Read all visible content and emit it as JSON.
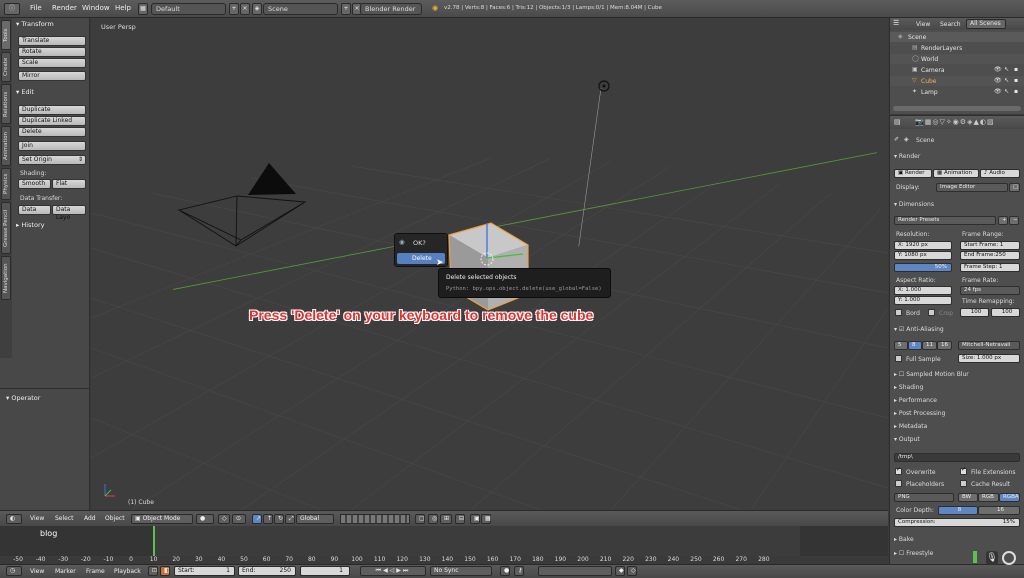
{
  "topbar": {
    "menus": [
      "File",
      "Render",
      "Window",
      "Help"
    ],
    "layout": "Default",
    "scene": "Scene",
    "engine": "Blender Render",
    "stats": "v2.78 | Verts:8 | Faces:6 | Tris:12 | Objects:1/3 | Lamps:0/1 | Mem:8.04M | Cube"
  },
  "toolbar": {
    "tabs": [
      "Tools",
      "Create",
      "Relations",
      "Animation",
      "Physics",
      "Grease Pencil"
    ],
    "tabs2": [
      "Navigation"
    ],
    "transform_header": "Transform",
    "translate": "Translate",
    "rotate": "Rotate",
    "scale": "Scale",
    "mirror": "Mirror",
    "edit_header": "Edit",
    "duplicate": "Duplicate",
    "duplicate_linked": "Duplicate Linked",
    "delete": "Delete",
    "join": "Join",
    "set_origin": "Set Origin",
    "shading_label": "Shading:",
    "smooth": "Smooth",
    "flat": "Flat",
    "data_transfer_label": "Data Transfer:",
    "data": "Data",
    "data_layout": "Data Layo",
    "history_header": "History",
    "operator_header": "Operator"
  },
  "viewport": {
    "view_name": "User Persp",
    "object_label": "(1) Cube",
    "popup_ok": "OK?",
    "popup_delete": "Delete",
    "tooltip_title": "Delete selected objects",
    "tooltip_python": "Python: bpy.ops.object.delete(use_global=False)",
    "instruction": "Press 'Delete' on your keyboard to remove the cube",
    "instruction_color": "#e03030"
  },
  "header3d": {
    "view": "View",
    "select": "Select",
    "add": "Add",
    "object": "Object",
    "mode": "Object Mode",
    "orientation": "Global"
  },
  "timeline": {
    "watermark": "blog",
    "ticks": [
      "-50",
      "-40",
      "-30",
      "-20",
      "-10",
      "0",
      "10",
      "20",
      "30",
      "40",
      "50",
      "60",
      "70",
      "80",
      "90",
      "100",
      "110",
      "120",
      "130",
      "140",
      "150",
      "160",
      "170",
      "180",
      "190",
      "200",
      "210",
      "220",
      "230",
      "240",
      "250",
      "260",
      "270",
      "280"
    ],
    "view": "View",
    "marker": "Marker",
    "frame": "Frame",
    "playback": "Playback",
    "start_label": "Start:",
    "start_value": "1",
    "end_label": "End:",
    "end_value": "250",
    "current": "1",
    "sync": "No Sync"
  },
  "outliner": {
    "view": "View",
    "search": "Search",
    "filter": "All Scenes",
    "items": [
      "Scene",
      "RenderLayers",
      "World",
      "Camera",
      "Cube",
      "Lamp"
    ]
  },
  "properties": {
    "scene_path": "Scene",
    "render_header": "Render",
    "render_btn": "Render",
    "animation_btn": "Animation",
    "audio_btn": "Audio",
    "display_label": "Display:",
    "display_value": "Image Editor",
    "dimensions_header": "Dimensions",
    "render_presets": "Render Presets",
    "resolution_label": "Resolution:",
    "res_x": "X:     1920 px",
    "res_y": "Y:     1080 px",
    "res_pct": "50%",
    "frame_range_label": "Frame Range:",
    "start_frame": "Start Frame:  1",
    "end_frame": "End Frame:250",
    "frame_step": "Frame Step:  1",
    "aspect_label": "Aspect Ratio:",
    "asp_x": "X:       1.000",
    "asp_y": "Y:       1.000",
    "frame_rate_label": "Frame Rate:",
    "fps": "24 fps",
    "time_remap_label": "Time Remapping:",
    "remap_old": "100",
    "remap_new": "100",
    "border": "Bord",
    "crop": "Crop",
    "aa_header": "Anti-Aliasing",
    "aa_5": "5",
    "aa_8": "8",
    "aa_11": "11",
    "aa_16": "16",
    "aa_filter": "Mitchell-Netravali",
    "full_sample": "Full Sample",
    "size": "Size: 1.000 px",
    "motion_blur": "Sampled Motion Blur",
    "shading": "Shading",
    "performance": "Performance",
    "post_processing": "Post Processing",
    "metadata": "Metadata",
    "output_header": "Output",
    "output_path": "/tmp\\",
    "overwrite": "Overwrite",
    "file_ext": "File Extensions",
    "placeholders": "Placeholders",
    "cache_result": "Cache Result",
    "format": "PNG",
    "bw": "BW",
    "rgb": "RGB",
    "rgba": "RGBA",
    "color_depth_label": "Color Depth:",
    "depth_8": "8",
    "depth_16": "16",
    "compression": "Compression:",
    "compression_value": "15%",
    "bake": "Bake",
    "freestyle": "Freestyle"
  }
}
